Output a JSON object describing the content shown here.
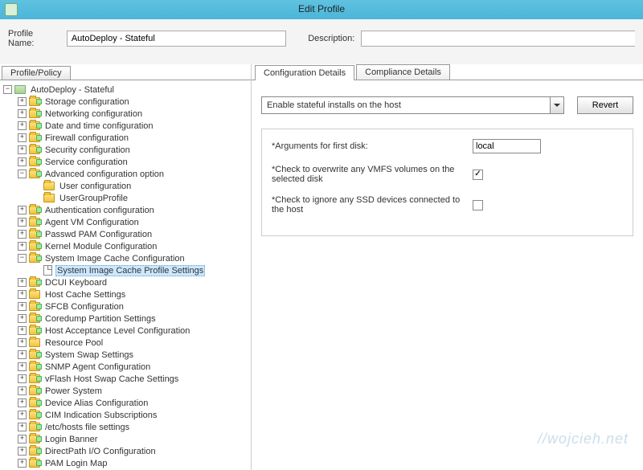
{
  "window_title": "Edit Profile",
  "header": {
    "profile_name_label": "Profile Name:",
    "profile_name_value": "AutoDeploy - Stateful",
    "description_label": "Description:",
    "description_value": ""
  },
  "left_tab_label": "Profile/Policy",
  "right_tabs": {
    "config": "Configuration Details",
    "compliance": "Compliance Details"
  },
  "tree": {
    "root": "AutoDeploy - Stateful",
    "items": [
      {
        "exp": "+",
        "icon": "fg",
        "label": "Storage configuration"
      },
      {
        "exp": "+",
        "icon": "fg",
        "label": "Networking configuration"
      },
      {
        "exp": "+",
        "icon": "fg",
        "label": "Date and time configuration"
      },
      {
        "exp": "+",
        "icon": "fg",
        "label": "Firewall configuration"
      },
      {
        "exp": "+",
        "icon": "fg",
        "label": "Security configuration"
      },
      {
        "exp": "+",
        "icon": "fg",
        "label": "Service configuration"
      },
      {
        "exp": "-",
        "icon": "fg",
        "label": "Advanced configuration option"
      },
      {
        "exp": " ",
        "icon": "f",
        "label": "User configuration",
        "indent": 1
      },
      {
        "exp": " ",
        "icon": "f",
        "label": "UserGroupProfile",
        "indent": 1
      },
      {
        "exp": "+",
        "icon": "fg",
        "label": "Authentication configuration"
      },
      {
        "exp": "+",
        "icon": "fg",
        "label": "Agent VM Configuration"
      },
      {
        "exp": "+",
        "icon": "fg",
        "label": "Passwd PAM Configuration"
      },
      {
        "exp": "+",
        "icon": "fg",
        "label": "Kernel Module Configuration"
      },
      {
        "exp": "-",
        "icon": "fg",
        "label": "System Image Cache Configuration"
      },
      {
        "exp": " ",
        "icon": "p",
        "label": "System Image Cache Profile Settings",
        "indent": 1,
        "selected": true
      },
      {
        "exp": "+",
        "icon": "fg",
        "label": "DCUI Keyboard"
      },
      {
        "exp": "+",
        "icon": "f",
        "label": "Host Cache Settings"
      },
      {
        "exp": "+",
        "icon": "fg",
        "label": "SFCB Configuration"
      },
      {
        "exp": "+",
        "icon": "fg",
        "label": "Coredump Partition Settings"
      },
      {
        "exp": "+",
        "icon": "fg",
        "label": "Host Acceptance Level Configuration"
      },
      {
        "exp": "+",
        "icon": "f",
        "label": "Resource Pool"
      },
      {
        "exp": "+",
        "icon": "fg",
        "label": "System Swap Settings"
      },
      {
        "exp": "+",
        "icon": "fg",
        "label": "SNMP Agent Configuration"
      },
      {
        "exp": "+",
        "icon": "fg",
        "label": "vFlash Host Swap Cache Settings"
      },
      {
        "exp": "+",
        "icon": "fg",
        "label": "Power System"
      },
      {
        "exp": "+",
        "icon": "fg",
        "label": "Device Alias Configuration"
      },
      {
        "exp": "+",
        "icon": "fg",
        "label": "CIM Indication Subscriptions"
      },
      {
        "exp": "+",
        "icon": "fg",
        "label": "/etc/hosts file settings"
      },
      {
        "exp": "+",
        "icon": "fg",
        "label": "Login Banner"
      },
      {
        "exp": "+",
        "icon": "fg",
        "label": "DirectPath I/O Configuration"
      },
      {
        "exp": "+",
        "icon": "fg",
        "label": "PAM Login Map"
      }
    ]
  },
  "details": {
    "dropdown_value": "Enable stateful installs on the host",
    "revert_label": "Revert",
    "arg_label": "*Arguments for first disk:",
    "arg_value": "local",
    "vmfs_label": "*Check to overwrite any VMFS volumes on the selected disk",
    "vmfs_checked": true,
    "ssd_label": "*Check to ignore any SSD devices connected to the host",
    "ssd_checked": false
  },
  "watermark": "//wojcieh.net"
}
